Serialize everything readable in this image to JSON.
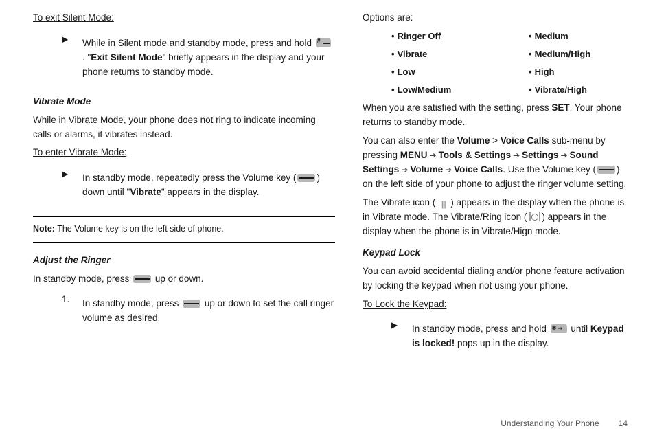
{
  "left": {
    "exitSilentHeading": "To exit Silent Mode:",
    "exitSilentStep": {
      "part1": "While in Silent mode and standby mode, press and hold",
      "quotedBold": "Exit Silent Mode",
      "part2": "\" briefly appears in the display and your phone returns to standby mode.",
      "openQuote": ". \""
    },
    "vibrateModeHead": "Vibrate Mode",
    "vibratePara": "While in Vibrate Mode, your phone does not ring to indicate incoming calls or alarms, it vibrates instead.",
    "enterVibrateHead": "To enter Vibrate Mode:",
    "enterVibrateStep": {
      "a": "In standby mode, repeatedly press the Volume key (",
      "b": ") down until \"",
      "bold": "Vibrate",
      "c": "\" appears in the display."
    },
    "note": {
      "label": "Note:",
      "text": " The Volume key is on the left side of phone."
    },
    "adjustRingerHead": "Adjust the Ringer",
    "adjustIntro": {
      "a": "In standby mode, press ",
      "b": " up or down."
    },
    "adjustStep1": {
      "num": "1.",
      "a": "In standby mode, press ",
      "b": " up or down to set the call ringer volume as desired."
    }
  },
  "right": {
    "optionsHead": "Options are:",
    "options": [
      "Ringer Off",
      "Medium",
      "Vibrate",
      "Medium/High",
      "Low",
      "High",
      "Low/Medium",
      "Vibrate/High"
    ],
    "satisfied": {
      "a": "When you are satisfied with the setting, press ",
      "set": "SET",
      "b": ". Your phone returns to standby mode."
    },
    "menuPara": {
      "a": "You can also enter the ",
      "vol": "Volume",
      "gt": " > ",
      "vc": "Voice Calls",
      "b": " sub-menu by pressing ",
      "m1": "MENU",
      "arr": " ➔ ",
      "m2": "Tools & Settings",
      "m3": "Settings",
      "m4": "Sound Settings",
      "m5": "Volume",
      "m6": "Voice Calls",
      "c": ". Use the Volume key (",
      "d": ") on the left side of your phone to adjust the ringer volume setting."
    },
    "vibIconPara": {
      "a": "The Vibrate icon (",
      "b": ") appears in the display when the phone is in Vibrate mode. The Vibrate/Ring icon (",
      "c": ") appears in the display when the phone is in Vibrate/Hign mode."
    },
    "keypadHead": "Keypad Lock",
    "keypadPara": "You can avoid accidental dialing and/or phone feature activation by locking the keypad when not using your phone.",
    "lockHead": "To Lock the Keypad:",
    "lockStep": {
      "a": "In standby mode, press and hold ",
      "b": " until ",
      "bold": "Keypad is locked!",
      "c": " pops up in the display."
    }
  },
  "footer": {
    "section": "Understanding Your Phone",
    "page": "14"
  }
}
